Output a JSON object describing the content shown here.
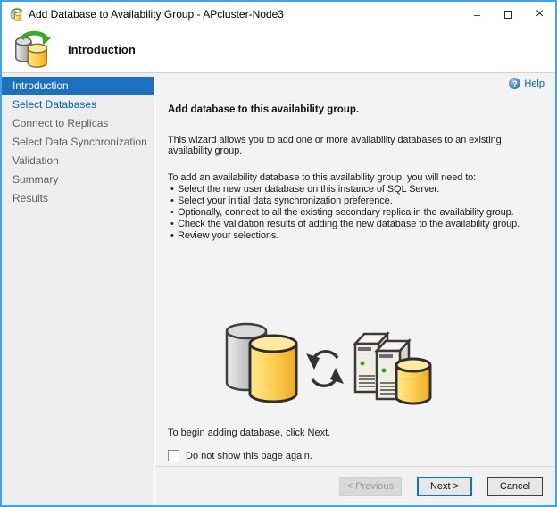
{
  "window": {
    "title": "Add Database to Availability Group - APcluster-Node3",
    "controls": {
      "minimize": "–",
      "close": "×"
    }
  },
  "header": {
    "title": "Introduction"
  },
  "sidebar": {
    "items": [
      {
        "label": "Introduction",
        "state": "selected"
      },
      {
        "label": "Select Databases",
        "state": "link"
      },
      {
        "label": "Connect to Replicas",
        "state": "pending"
      },
      {
        "label": "Select Data Synchronization",
        "state": "pending"
      },
      {
        "label": "Validation",
        "state": "pending"
      },
      {
        "label": "Summary",
        "state": "pending"
      },
      {
        "label": "Results",
        "state": "pending"
      }
    ]
  },
  "content": {
    "help_label": "Help",
    "heading": "Add database to this availability group.",
    "intro": "This wizard allows you to add one or more availability databases to an existing availability group.",
    "steps_intro": "To add an availability database to this availability group, you will need to:",
    "steps": [
      "Select the new user database on this instance of SQL Server.",
      "Select your initial data synchronization preference.",
      "Optionally, connect to all the existing secondary replica in the availability group.",
      "Check the validation results of adding the new database to the availability group.",
      "Review your selections."
    ],
    "begin_text": "To begin adding database, click Next.",
    "checkbox_label": "Do not show this page again.",
    "checkbox_checked": false
  },
  "footer": {
    "previous_label": "< Previous",
    "next_label": "Next >",
    "cancel_label": "Cancel"
  },
  "icons": {
    "bullet": "•",
    "help_question": "?",
    "titlebar_icon": "database-sync-icon",
    "header_icon": "database-sync-icon",
    "illustration": "databases-sync-servers-illustration"
  },
  "colors": {
    "window_border": "#42a3e8",
    "selected_step_blue": "#1c70bf",
    "link_blue": "#0063b1",
    "default_button_border": "#0078d7",
    "sidebar_bg": "#eeeeee",
    "content_bg": "#f3f3f3"
  }
}
